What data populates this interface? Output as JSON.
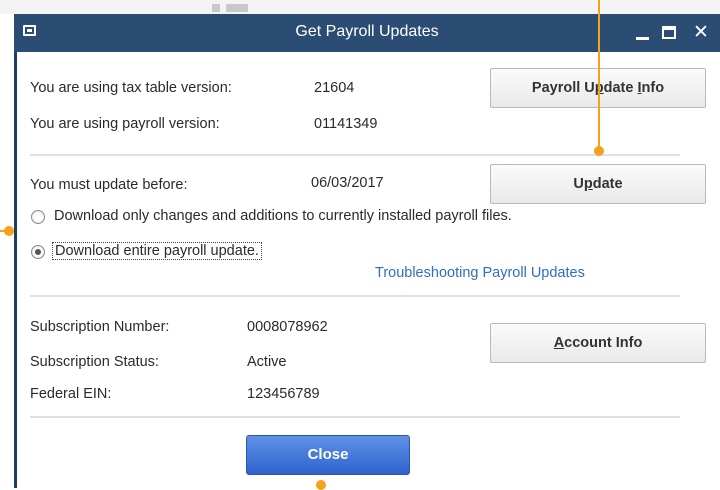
{
  "window": {
    "title": "Get Payroll Updates"
  },
  "info": {
    "tax_table_label": "You are using tax table version:",
    "tax_table_value": "21604",
    "payroll_version_label": "You are using payroll version:",
    "payroll_version_value": "01141349",
    "update_before_label": "You must update before:",
    "update_before_value": "06/03/2017"
  },
  "buttons": {
    "payroll_update_info_pre": "Payroll U",
    "payroll_update_info_u": "p",
    "payroll_update_info_mid": "date ",
    "payroll_update_info_u2": "I",
    "payroll_update_info_post": "nfo",
    "update_pre": "U",
    "update_u": "p",
    "update_post": "date",
    "account_info_u": "A",
    "account_info_post": "ccount Info",
    "close": "Close"
  },
  "options": {
    "download_changes": "Download only changes and additions to currently installed payroll files.",
    "download_entire": "Download entire payroll update.",
    "selected": "download_entire"
  },
  "links": {
    "troubleshooting": "Troubleshooting Payroll Updates"
  },
  "subscription": {
    "number_label": "Subscription Number:",
    "number_value": "0008078962",
    "status_label": "Subscription Status:",
    "status_value": "Active",
    "ein_label": "Federal EIN:",
    "ein_value": "123456789"
  },
  "colors": {
    "titlebar": "#2b4d74",
    "link": "#2f6fbf",
    "close_button": "#3a6fd8",
    "annotation": "#f4a21c"
  }
}
